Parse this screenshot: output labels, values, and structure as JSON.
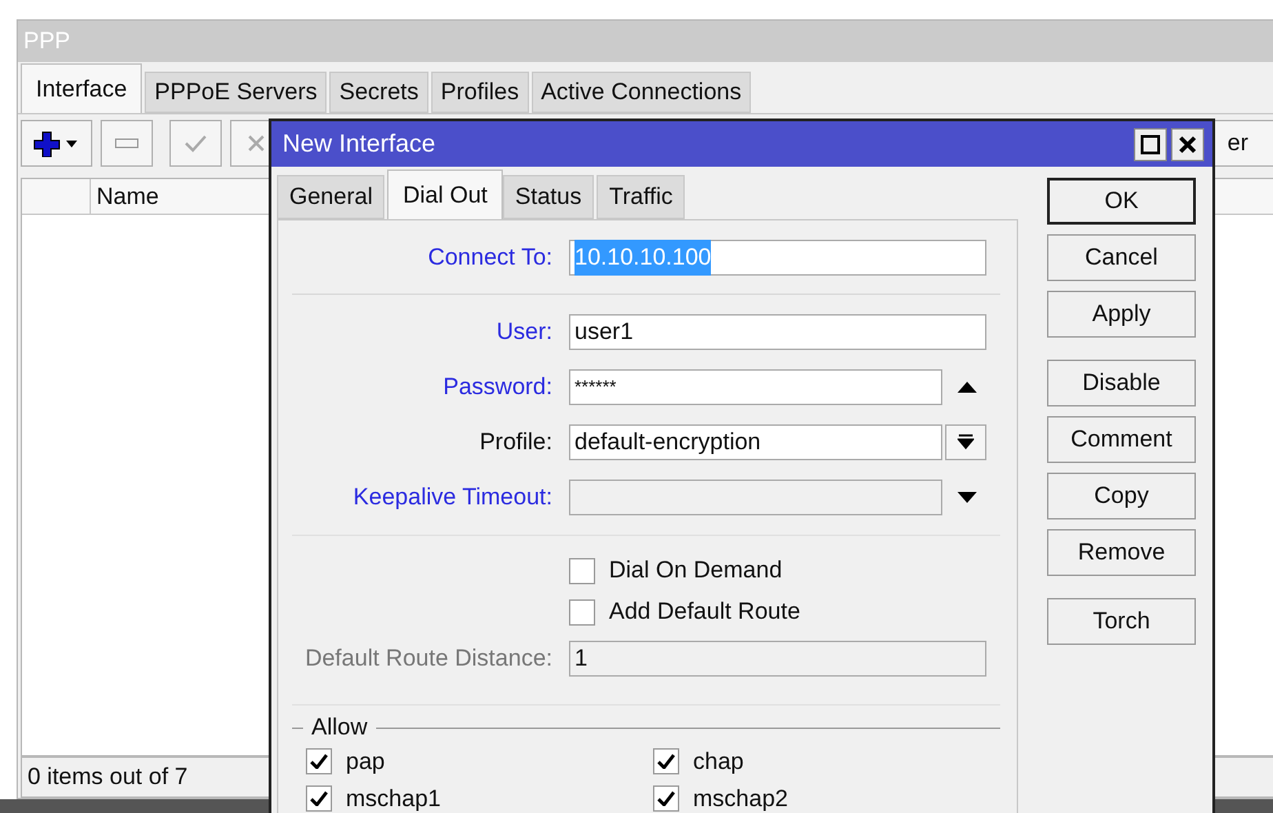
{
  "window": {
    "title": "PPP"
  },
  "tabs": [
    {
      "label": "Interface",
      "selected": true
    },
    {
      "label": "PPPoE Servers",
      "selected": false
    },
    {
      "label": "Secrets",
      "selected": false
    },
    {
      "label": "Profiles",
      "selected": false
    },
    {
      "label": "Active Connections",
      "selected": false
    }
  ],
  "toolbar": {
    "cut_button_label": "er"
  },
  "table": {
    "columns": [
      "Name"
    ]
  },
  "status_bar": "0 items out of 7",
  "dialog": {
    "title": "New Interface",
    "tabs": [
      {
        "label": "General",
        "selected": false
      },
      {
        "label": "Dial Out",
        "selected": true
      },
      {
        "label": "Status",
        "selected": false
      },
      {
        "label": "Traffic",
        "selected": false
      }
    ],
    "connect_to": {
      "label": "Connect To:",
      "value": "10.10.10.100",
      "highlighted": true,
      "text_selected": true
    },
    "fields": [
      {
        "label": "User:",
        "value": "user1",
        "kind": "text",
        "highlighted": true
      },
      {
        "label": "Password:",
        "value": "******",
        "kind": "password",
        "highlighted": true
      },
      {
        "label": "Profile:",
        "value": "default-encryption",
        "kind": "select",
        "highlighted": false
      },
      {
        "label": "Keepalive Timeout:",
        "kind": "optional",
        "highlighted": true
      }
    ],
    "options": [
      {
        "label": "Dial On Demand",
        "checked": false
      },
      {
        "label": "Add Default Route",
        "checked": false
      }
    ],
    "default_route_distance": {
      "label": "Default Route Distance:",
      "value": "1",
      "disabled": true
    },
    "allow": {
      "title": "Allow",
      "items": [
        {
          "label": "pap",
          "checked": true
        },
        {
          "label": "chap",
          "checked": true
        },
        {
          "label": "mschap1",
          "checked": true
        },
        {
          "label": "mschap2",
          "checked": true
        }
      ]
    },
    "button_groups": [
      [
        {
          "label": "OK",
          "default": true
        },
        {
          "label": "Cancel",
          "default": false
        },
        {
          "label": "Apply",
          "default": false
        }
      ],
      [
        {
          "label": "Disable",
          "default": false
        },
        {
          "label": "Comment",
          "default": false
        },
        {
          "label": "Copy",
          "default": false
        },
        {
          "label": "Remove",
          "default": false
        }
      ],
      [
        {
          "label": "Torch",
          "default": false
        }
      ]
    ]
  }
}
